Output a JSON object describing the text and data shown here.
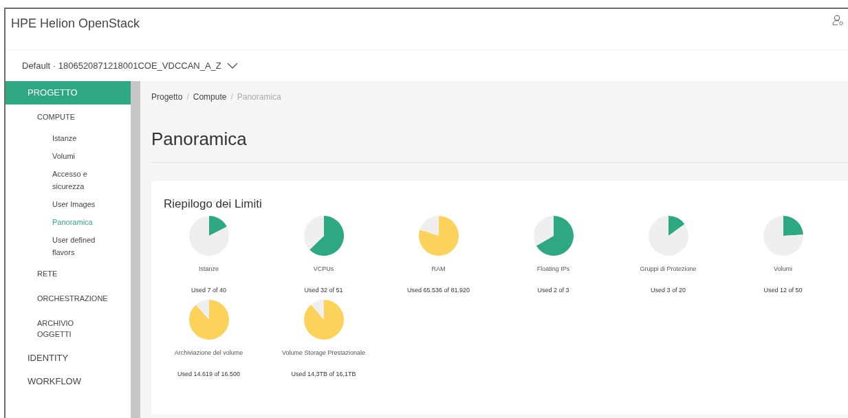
{
  "header": {
    "title": "HPE Helion OpenStack"
  },
  "project_selector": {
    "value": "Default · 1806520871218001COE_VDCCAN_A_Z"
  },
  "sidebar": {
    "items": [
      {
        "label": "PROGETTO",
        "selected": true,
        "children": [
          {
            "label": "COMPUTE",
            "children": [
              {
                "label": "Istanze",
                "selected": false
              },
              {
                "label": "Volumi",
                "selected": false
              },
              {
                "label": "Accesso e sicurezza",
                "selected": false
              },
              {
                "label": "User Images",
                "selected": false
              },
              {
                "label": "Panoramica",
                "selected": true
              },
              {
                "label": "User defined flavors",
                "selected": false
              }
            ]
          },
          {
            "label": "RETE"
          },
          {
            "label": "ORCHESTRAZIONE"
          },
          {
            "label": "ARCHIVIO OGGETTI"
          }
        ]
      },
      {
        "label": "IDENTITY",
        "selected": false
      },
      {
        "label": "WORKFLOW",
        "selected": false
      }
    ]
  },
  "breadcrumb": {
    "separator": "/",
    "items": [
      {
        "label": "Progetto",
        "selected": false
      },
      {
        "label": "Compute",
        "selected": false
      },
      {
        "label": "Panoramica",
        "selected": true
      }
    ]
  },
  "page_title": "Panoramica",
  "limits": {
    "title": "Riepilogo dei Limiti",
    "items": [
      {
        "name": "Istanze",
        "reading": "Used 7 of 40",
        "color": "#2ea882",
        "chart_data": {
          "type": "pie",
          "values": [
            17.5,
            82.5
          ]
        }
      },
      {
        "name": "VCPUs",
        "reading": "Used 32 of 51",
        "color": "#2ea882",
        "chart_data": {
          "type": "pie",
          "values": [
            62.7,
            37.3
          ]
        }
      },
      {
        "name": "RAM",
        "reading": "Used 65.536 of 81.920",
        "color": "#fdd25a",
        "chart_data": {
          "type": "pie",
          "values": [
            80,
            20
          ]
        }
      },
      {
        "name": "Floating IPs",
        "reading": "Used 2 of 3",
        "color": "#2ea882",
        "chart_data": {
          "type": "pie",
          "values": [
            66.7,
            33.3
          ]
        }
      },
      {
        "name": "Gruppi di Protezione",
        "reading": "Used 3 of 20",
        "color": "#2ea882",
        "chart_data": {
          "type": "pie",
          "values": [
            15,
            85
          ]
        }
      },
      {
        "name": "Volumi",
        "reading": "Used 12 of 50",
        "color": "#2ea882",
        "chart_data": {
          "type": "pie",
          "values": [
            24,
            76
          ]
        }
      },
      {
        "name": "Archiviazione del volume",
        "reading": "Used 14.619 of 16.500",
        "color": "#fdd25a",
        "chart_data": {
          "type": "pie",
          "values": [
            88.6,
            11.4
          ]
        }
      },
      {
        "name": "Volume Storage Prestazionale",
        "reading": "Used 14,3TB of 16,1TB",
        "color": "#fdd25a",
        "chart_data": {
          "type": "pie",
          "values": [
            88.8,
            11.2
          ]
        }
      }
    ]
  }
}
